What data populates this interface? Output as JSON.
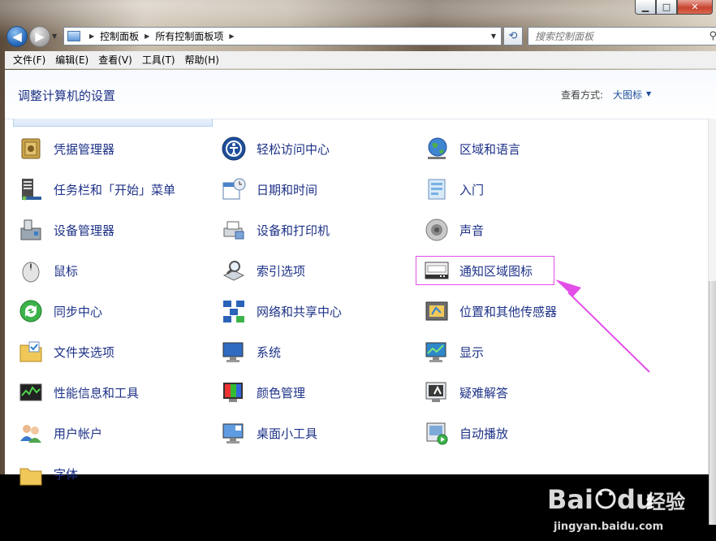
{
  "window": {
    "minimize_label": "▁",
    "maximize_label": "□",
    "close_label": "✕"
  },
  "nav": {
    "breadcrumb": [
      "控制面板",
      "所有控制面板项"
    ],
    "search_placeholder": "搜索控制面板"
  },
  "menu": [
    "文件(F)",
    "编辑(E)",
    "查看(V)",
    "工具(T)",
    "帮助(H)"
  ],
  "header": {
    "title": "调整计算机的设置",
    "view_by_label": "查看方式:",
    "view_by_value": "大图标"
  },
  "items": {
    "col1": [
      "凭据管理器",
      "任务栏和「开始」菜单",
      "设备管理器",
      "鼠标",
      "同步中心",
      "文件夹选项",
      "性能信息和工具",
      "用户帐户",
      "字体"
    ],
    "col2": [
      "轻松访问中心",
      "日期和时间",
      "设备和打印机",
      "索引选项",
      "网络和共享中心",
      "系统",
      "颜色管理",
      "桌面小工具"
    ],
    "col3": [
      "区域和语言",
      "入门",
      "声音",
      "通知区域图标",
      "位置和其他传感器",
      "显示",
      "疑难解答",
      "自动播放"
    ]
  },
  "highlighted_item": "通知区域图标",
  "annotation_color": "#e24ee8",
  "watermark": {
    "brand": "Bai",
    "brand2": "du",
    "suffix": "经验",
    "url": "jingyan.baidu.com"
  }
}
